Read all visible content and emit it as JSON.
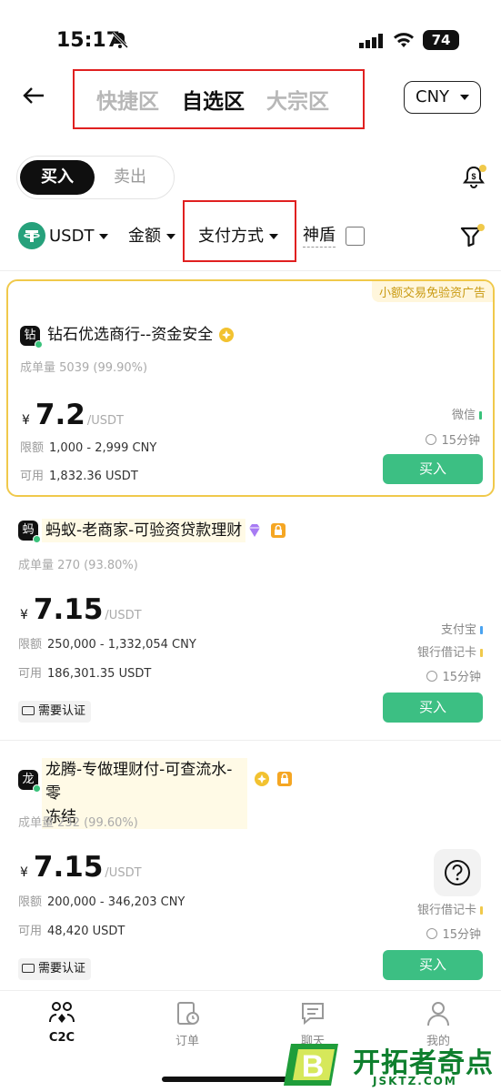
{
  "status_bar": {
    "time": "15:17",
    "battery": "74"
  },
  "header": {
    "tabs": [
      {
        "label": "快捷区",
        "active": false
      },
      {
        "label": "自选区",
        "active": true
      },
      {
        "label": "大宗区",
        "active": false
      }
    ],
    "currency": "CNY"
  },
  "trade_toggle": {
    "buy": "买入",
    "sell": "卖出",
    "selected": "buy"
  },
  "filters": {
    "asset": "USDT",
    "amount": "金额",
    "payment": "支付方式",
    "shield": "神盾",
    "shield_checked": false
  },
  "ads": [
    {
      "tag": "小额交易免验资广告",
      "avatar": "钻",
      "merchant": "钻石优选商行--资金安全",
      "volume_label": "成单量",
      "volume": "5039 (99.90%)",
      "currency_symbol": "¥",
      "price": "7.2",
      "unit": "/USDT",
      "limit_label": "限额",
      "limit": "1,000 - 2,999 CNY",
      "available_label": "可用",
      "available": "1,832.36 USDT",
      "payment_methods": [
        {
          "name": "微信",
          "color": "#3ac27b"
        }
      ],
      "time_limit": "15分钟",
      "button": "买入"
    },
    {
      "avatar": "蚂",
      "merchant": "蚂蚁-老商家-可验资贷款理财",
      "volume_label": "成单量",
      "volume": "270 (93.80%)",
      "currency_symbol": "¥",
      "price": "7.15",
      "unit": "/USDT",
      "limit_label": "限额",
      "limit": "250,000 - 1,332,054 CNY",
      "available_label": "可用",
      "available": "186,301.35 USDT",
      "payment_methods": [
        {
          "name": "支付宝",
          "color": "#4aa3f0"
        },
        {
          "name": "银行借记卡",
          "color": "#f0c94b"
        }
      ],
      "time_limit": "15分钟",
      "verify": "需要认证",
      "button": "买入"
    },
    {
      "avatar": "龙",
      "merchant_line1": "龙腾-专做理财付-可查流水-零",
      "merchant_line2": "冻结",
      "volume_label": "成单量",
      "volume": "232 (99.60%)",
      "currency_symbol": "¥",
      "price": "7.15",
      "unit": "/USDT",
      "limit_label": "限额",
      "limit": "200,000 - 346,203 CNY",
      "available_label": "可用",
      "available": "48,420 USDT",
      "payment_methods": [
        {
          "name": "银行借记卡",
          "color": "#f0c94b"
        }
      ],
      "time_limit": "15分钟",
      "verify": "需要认证",
      "button": "买入"
    }
  ],
  "bottom_nav": [
    {
      "label": "C2C",
      "active": true
    },
    {
      "label": "订单",
      "active": false
    },
    {
      "label": "聊天",
      "active": false
    },
    {
      "label": "我的",
      "active": false
    }
  ],
  "watermark": {
    "title": "开拓者奇点",
    "domain": "JSKTZ.COM",
    "logo_letter": "B"
  },
  "colors": {
    "accent_green": "#3cbf83",
    "highlight_border": "#f0c94b",
    "annotation_red": "#e02020"
  }
}
